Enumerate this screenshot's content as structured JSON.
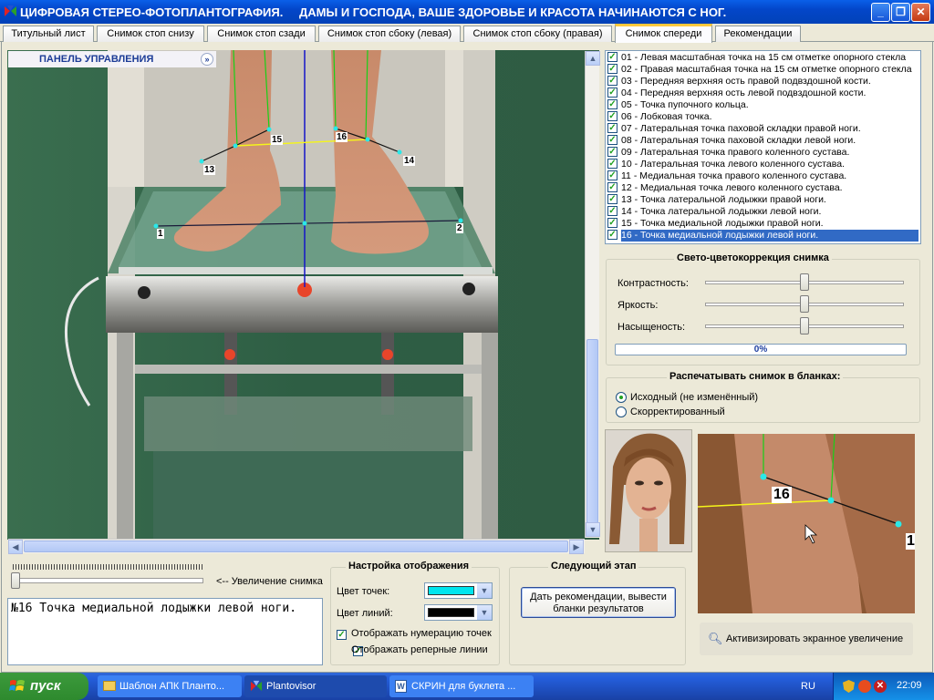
{
  "window": {
    "title_left": "ЦИФРОВАЯ СТЕРЕО-ФОТОПЛАНТОГРАФИЯ.",
    "title_right": "ДАМЫ И ГОСПОДА, ВАШЕ ЗДОРОВЬЕ И КРАСОТА НАЧИНАЮТСЯ С НОГ."
  },
  "tabs": [
    {
      "label": "Титульный лист"
    },
    {
      "label": "Снимок стоп снизу"
    },
    {
      "label": "Снимок стоп сзади"
    },
    {
      "label": "Снимок стоп сбоку (левая)"
    },
    {
      "label": "Снимок стоп сбоку (правая)"
    },
    {
      "label": "Снимок спереди"
    },
    {
      "label": "Рекомендации"
    }
  ],
  "active_tab": "Снимок спереди",
  "control_panel": {
    "label": "ПАНЕЛЬ УПРАВЛЕНИЯ"
  },
  "photo_markers": [
    "15",
    "16",
    "13",
    "14",
    "1",
    "2"
  ],
  "points": [
    "01 - Левая масштабная точка на 15 см отметке опорного стекла",
    "02 - Правая масштабная точка на 15 см отметке опорного стекла",
    "03 - Передняя верхняя ость правой подвздошной кости.",
    "04 - Передняя верхняя ость левой подвздошной кости.",
    "05 - Точка пупочного кольца.",
    "06 - Лобковая точка.",
    "07 - Латеральная точка паховой складки правой ноги.",
    "08 - Латеральная точка паховой складки левой ноги.",
    "09 - Латеральная точка правого коленного сустава.",
    "10 - Латеральная точка левого коленного сустава.",
    "11 - Медиальная точка правого коленного сустава.",
    "12 - Медиальная точка левого коленного сустава.",
    "13 - Точка латеральной лодыжки правой ноги.",
    "14 - Точка латеральной лодыжки левой ноги.",
    "15 - Точка медиальной лодыжки правой ноги.",
    "16 - Точка медиальной лодыжки левой ноги."
  ],
  "color_correction": {
    "title": "Свето-цветокоррекция снимка",
    "contrast_label": "Контрастность:",
    "brightness_label": "Яркость:",
    "saturation_label": "Насыщеность:",
    "contrast": 0.5,
    "brightness": 0.5,
    "saturation": 0.5,
    "progress": "0%"
  },
  "print": {
    "title": "Распечатывать снимок в бланках:",
    "option_original": "Исходный (не изменённый)",
    "option_corrected": "Скорректированный",
    "selected": "original"
  },
  "zoom": {
    "label": "<-- Увеличение снимка",
    "magnifier_marker": "16",
    "magnifier_edge_marker": "1",
    "activate_button": "Активизировать экранное увеличение"
  },
  "status_text": "№16 Точка медиальной лодыжки левой ноги.",
  "display_settings": {
    "title": "Настройка отображения",
    "point_color_label": "Цвет точек:",
    "line_color_label": "Цвет линий:",
    "point_color": "#00e5ee",
    "line_color": "#000000",
    "show_numbering": "Отображать нумерацию точек",
    "show_reference_lines": "Отображать реперные линии"
  },
  "next_stage": {
    "title": "Следующий этап",
    "button": "Дать рекомендации, вывести бланки результатов"
  },
  "taskbar": {
    "start": "пуск",
    "tasks": [
      "Шаблон АПК Планто...",
      "Plantovisor",
      "СКРИН для буклета ..."
    ],
    "lang": "RU",
    "time": "22:09"
  }
}
